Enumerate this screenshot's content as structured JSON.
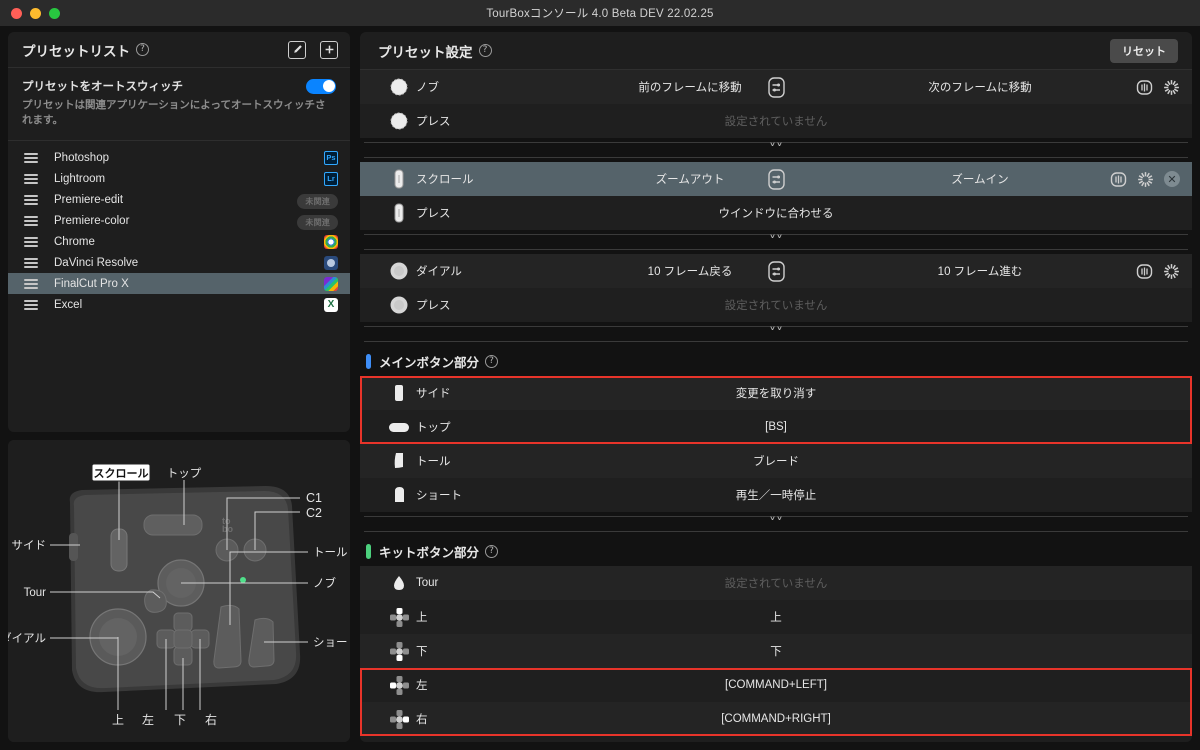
{
  "window": {
    "title": "TourBoxコンソール 4.0 Beta DEV 22.02.25",
    "traffic_lights": [
      "close",
      "minimize",
      "maximize"
    ]
  },
  "preset_panel": {
    "title": "プリセットリスト",
    "help": "?",
    "edit_icon": "edit-icon",
    "add_icon": "plus-icon",
    "autoswitch_label": "プリセットをオートスウィッチ",
    "autoswitch_on": true,
    "autoswitch_desc": "プリセットは関連アプリケーションによってオートスウィッチされます。",
    "items": [
      {
        "name": "Photoshop",
        "icon": "ps",
        "badge": "Ps",
        "selected": false
      },
      {
        "name": "Lightroom",
        "icon": "lr",
        "badge": "Lr",
        "selected": false
      },
      {
        "name": "Premiere-edit",
        "icon": "pill",
        "badge": "未関連",
        "selected": false
      },
      {
        "name": "Premiere-color",
        "icon": "pill",
        "badge": "未関連",
        "selected": false
      },
      {
        "name": "Chrome",
        "icon": "chrome",
        "badge": "",
        "selected": false
      },
      {
        "name": "DaVinci Resolve",
        "icon": "davinci",
        "badge": "",
        "selected": false
      },
      {
        "name": "FinalCut Pro X",
        "icon": "fcp",
        "badge": "",
        "selected": true
      },
      {
        "name": "Excel",
        "icon": "excel",
        "badge": "X",
        "selected": false
      }
    ]
  },
  "device_panel": {
    "brand": "tourbox",
    "callouts": [
      {
        "label": "スクロール",
        "highlighted": true
      },
      {
        "label": "トップ",
        "highlighted": false
      },
      {
        "label": "C1",
        "highlighted": false
      },
      {
        "label": "C2",
        "highlighted": false
      },
      {
        "label": "サイド",
        "highlighted": false
      },
      {
        "label": "ノブ",
        "highlighted": false
      },
      {
        "label": "Tour",
        "highlighted": false
      },
      {
        "label": "トール",
        "highlighted": false
      },
      {
        "label": "ダイアル",
        "highlighted": false
      },
      {
        "label": "ショート",
        "highlighted": false
      },
      {
        "label": "上",
        "highlighted": false
      },
      {
        "label": "左",
        "highlighted": false
      },
      {
        "label": "下",
        "highlighted": false
      },
      {
        "label": "右",
        "highlighted": false
      }
    ]
  },
  "settings_panel": {
    "title": "プリセット設定",
    "help": "?",
    "reset_label": "リセット",
    "unset_text": "設定されていません",
    "groups": [
      {
        "id": "knob",
        "rows": [
          {
            "label": "ノブ",
            "icon": "knob-icon",
            "kind": "dual",
            "left": "前のフレームに移動",
            "right": "次のフレームに移動",
            "mid_icon": "link-icon",
            "tools": [
              "haptic-icon",
              "speed-icon"
            ],
            "selected": false,
            "highlight": false
          },
          {
            "label": "プレス",
            "icon": "knob-icon",
            "kind": "single",
            "value": "設定されていません",
            "unset": true,
            "tools": [],
            "selected": false,
            "highlight": false
          }
        ]
      },
      {
        "id": "scroll",
        "rows": [
          {
            "label": "スクロール",
            "icon": "scroll-icon",
            "kind": "dual",
            "left": "ズームアウト",
            "right": "ズームイン",
            "mid_icon": "link-icon",
            "tools": [
              "haptic-icon",
              "speed-icon",
              "clear-icon"
            ],
            "selected": true,
            "highlight": false
          },
          {
            "label": "プレス",
            "icon": "scroll-icon",
            "kind": "single",
            "value": "ウインドウに合わせる",
            "unset": false,
            "tools": [],
            "selected": false,
            "highlight": false
          }
        ]
      },
      {
        "id": "dial",
        "rows": [
          {
            "label": "ダイアル",
            "icon": "dial-icon",
            "kind": "dual",
            "left": "10 フレーム戻る",
            "right": "10 フレーム進む",
            "mid_icon": "link-icon",
            "tools": [
              "haptic-icon",
              "speed-icon"
            ],
            "selected": false,
            "highlight": false
          },
          {
            "label": "プレス",
            "icon": "dial-icon",
            "kind": "single",
            "value": "設定されていません",
            "unset": true,
            "tools": [],
            "selected": false,
            "highlight": false
          }
        ]
      }
    ],
    "sections": [
      {
        "id": "main-buttons",
        "title": "メインボタン部分",
        "help": "?",
        "bar_color": "#3e8ef7",
        "rows": [
          {
            "label": "サイド",
            "icon": "side-button-icon",
            "value": "変更を取り消す",
            "unset": false,
            "highlight": true
          },
          {
            "label": "トップ",
            "icon": "top-button-icon",
            "value": "[BS]",
            "unset": false,
            "highlight": true
          },
          {
            "label": "トール",
            "icon": "tall-button-icon",
            "value": "ブレード",
            "unset": false,
            "highlight": false
          },
          {
            "label": "ショート",
            "icon": "short-button-icon",
            "value": "再生／一時停止",
            "unset": false,
            "highlight": false
          }
        ]
      },
      {
        "id": "kit-buttons",
        "title": "キットボタン部分",
        "help": "?",
        "bar_color": "#4cd07d",
        "rows": [
          {
            "label": "Tour",
            "icon": "tour-button-icon",
            "value": "設定されていません",
            "unset": true,
            "highlight": false
          },
          {
            "label": "上",
            "icon": "dpad-up-icon",
            "value": "上",
            "unset": false,
            "highlight": false
          },
          {
            "label": "下",
            "icon": "dpad-down-icon",
            "value": "下",
            "unset": false,
            "highlight": false
          },
          {
            "label": "左",
            "icon": "dpad-left-icon",
            "value": "[COMMAND+LEFT]",
            "unset": false,
            "highlight": true
          },
          {
            "label": "右",
            "icon": "dpad-right-icon",
            "value": "[COMMAND+RIGHT]",
            "unset": false,
            "highlight": true
          }
        ]
      }
    ]
  },
  "colors": {
    "accent_blue": "#0a84ff",
    "highlight_red": "#e8342a",
    "selected_row": "#55636a",
    "section_blue": "#3e8ef7",
    "section_green": "#4cd07d"
  }
}
